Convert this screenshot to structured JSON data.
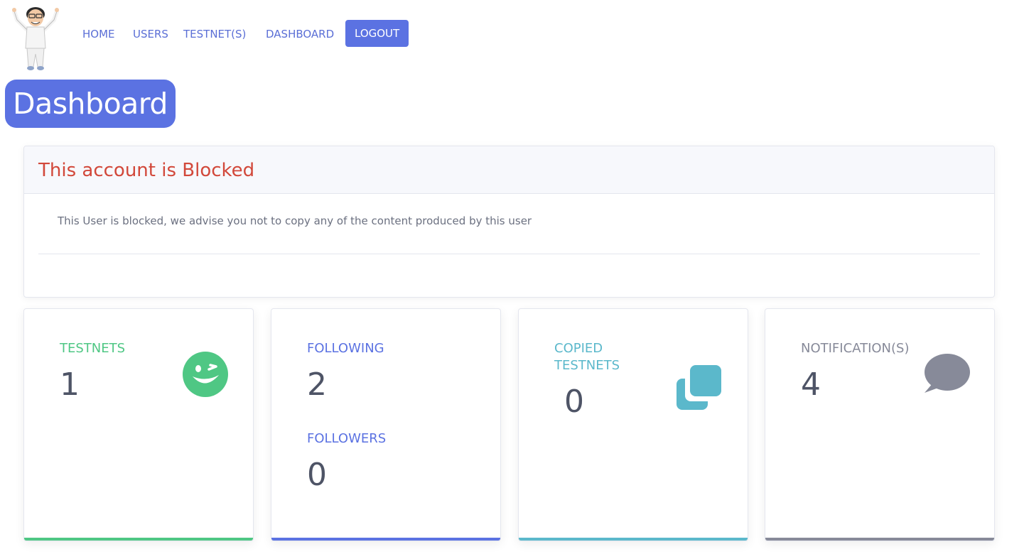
{
  "nav": {
    "home": "HOME",
    "users": "USERS",
    "testnets": "TESTNET(S)",
    "dashboard": "DASHBOARD",
    "logout": "LOGOUT"
  },
  "page_title": "Dashboard",
  "alert": {
    "title": "This account is Blocked",
    "message": "This User is blocked, we advise you not to copy any of the content produced by this user"
  },
  "stats": {
    "testnets": {
      "label": "TESTNETS",
      "value": "1",
      "icon": "wink-face-icon",
      "color": "#4fc784"
    },
    "following": {
      "label": "FOLLOWING",
      "value": "2",
      "color": "#5b72e2"
    },
    "followers": {
      "label": "FOLLOWERS",
      "value": "0",
      "color": "#5b72e2"
    },
    "copied": {
      "label_line1": "COPIED",
      "label_line2": "TESTNETS",
      "value": "0",
      "icon": "copy-icon",
      "color": "#5bb8cb"
    },
    "notifications": {
      "label": "NOTIFICATION(S)",
      "value": "4",
      "icon": "speech-bubble-icon",
      "color": "#878a99"
    }
  },
  "colors": {
    "accent": "#5b72e2",
    "alert_title": "#d2483a"
  }
}
